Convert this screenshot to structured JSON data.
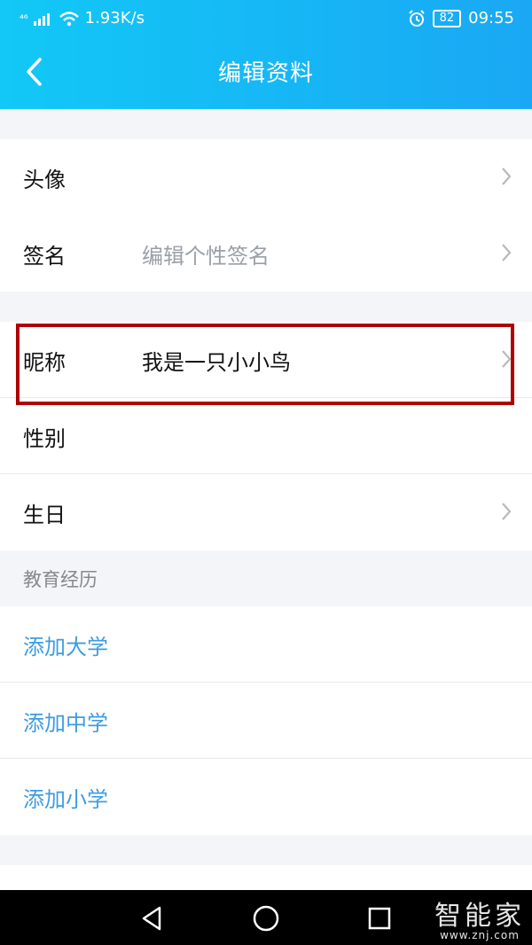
{
  "status_bar": {
    "signal_label": "⁴⁶",
    "net_speed": "1.93K/s",
    "battery": "82",
    "time": "09:55"
  },
  "header": {
    "title": "编辑资料",
    "back_icon": "back-chevron-icon"
  },
  "sections": {
    "basic": [
      {
        "label": "头像",
        "value": "",
        "hint": ""
      },
      {
        "label": "签名",
        "value": "",
        "hint": "编辑个性签名"
      }
    ],
    "profile": [
      {
        "label": "昵称",
        "value": "我是一只小小鸟"
      },
      {
        "label": "性别",
        "value": ""
      },
      {
        "label": "生日",
        "value": ""
      }
    ]
  },
  "education": {
    "title": "教育经历",
    "items": [
      "添加大学",
      "添加中学",
      "添加小学"
    ]
  },
  "navigation": {
    "icons": [
      "back-triangle-icon",
      "home-circle-icon",
      "recent-square-icon"
    ]
  },
  "watermark": {
    "logo": "智能家",
    "url": "www.znj.com"
  },
  "colors": {
    "header_start": "#12c8f6",
    "header_end": "#1aa8f4",
    "link": "#3d9de0",
    "highlight": "#b00000"
  }
}
